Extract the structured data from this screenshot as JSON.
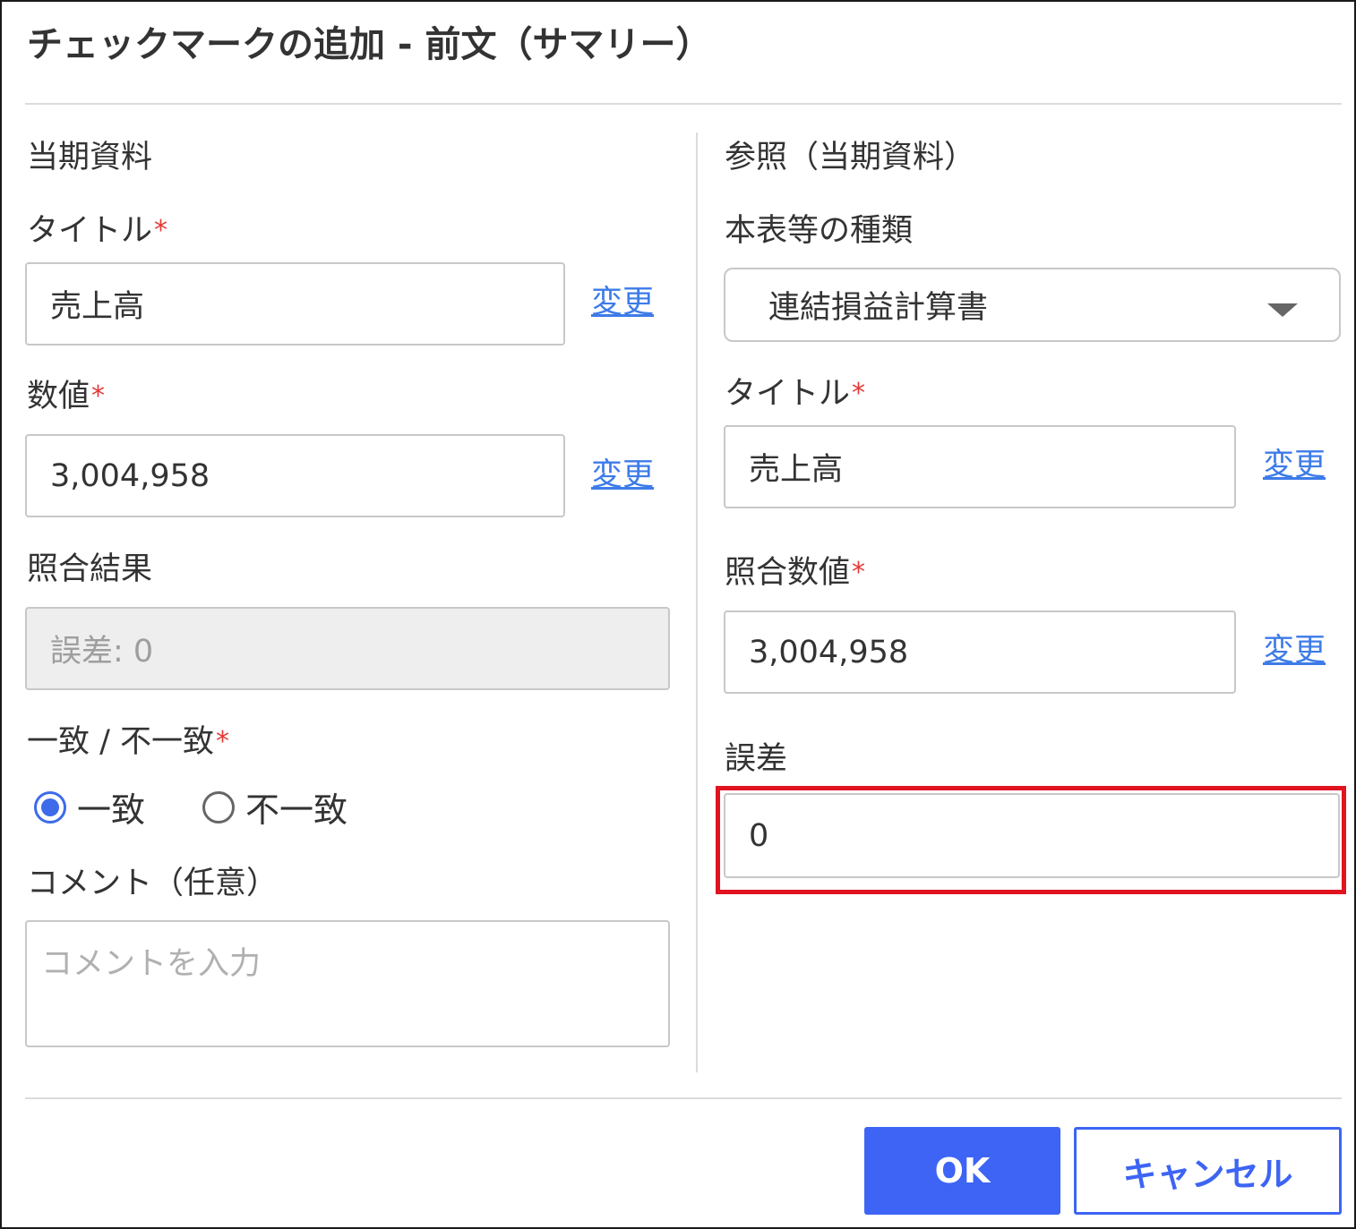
{
  "dialog": {
    "title": "チェックマークの追加 - 前文（サマリー）"
  },
  "left": {
    "section_title": "当期資料",
    "title_label": "タイトル",
    "title_value": "売上高",
    "title_change": "変更",
    "number_label": "数値",
    "number_value": "3,004,958",
    "number_change": "変更",
    "result_label": "照合結果",
    "result_value": "誤差: 0",
    "match_label": "一致 / 不一致",
    "match_options": [
      "一致",
      "不一致"
    ],
    "match_selected": "一致",
    "comment_label": "コメント（任意）",
    "comment_placeholder": "コメントを入力"
  },
  "right": {
    "section_title": "参照（当期資料）",
    "statement_label": "本表等の種類",
    "statement_value": "連結損益計算書",
    "title_label": "タイトル",
    "title_value": "売上高",
    "title_change": "変更",
    "match_number_label": "照合数値",
    "match_number_value": "3,004,958",
    "match_number_change": "変更",
    "diff_label": "誤差",
    "diff_value": "0"
  },
  "required_mark": "*",
  "footer": {
    "ok_label": "OK",
    "cancel_label": "キャンセル"
  },
  "colors": {
    "primary": "#3d64f5",
    "link": "#3d7be8",
    "required": "#e53935",
    "highlight": "#e0131f"
  }
}
